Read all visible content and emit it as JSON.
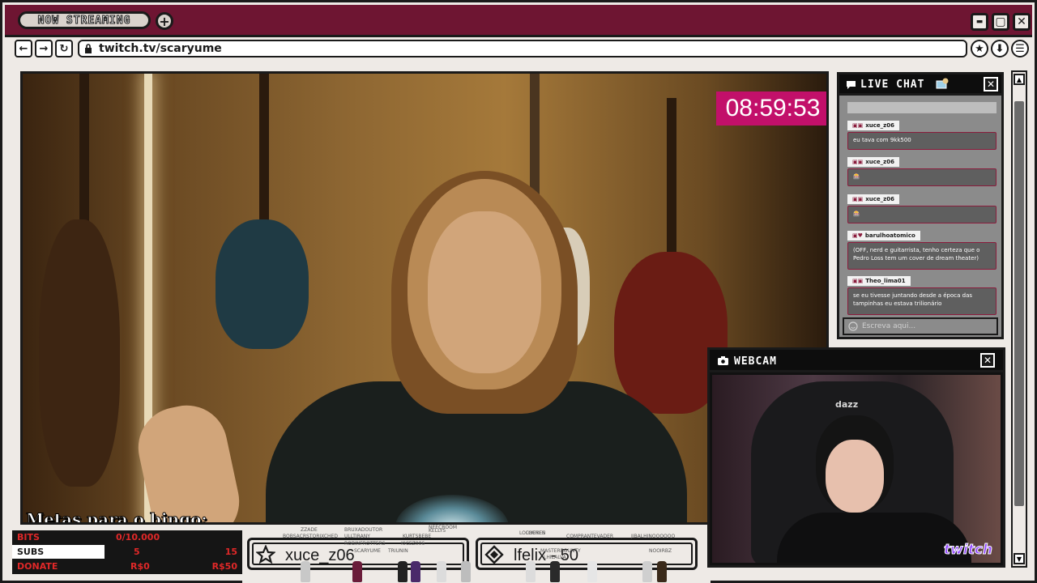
{
  "titlebar": {
    "now_streaming": "NOW STREAMING",
    "plus_icon": "+",
    "minimize_icon": "▬",
    "maximize_icon": "▢",
    "close_icon": "✕"
  },
  "navbar": {
    "back_icon": "←",
    "forward_icon": "→",
    "refresh_icon": "↻",
    "url": "twitch.tv/scaryume",
    "bookmark_icon": "★",
    "download_icon": "⬇",
    "menu_icon": "☰"
  },
  "stream": {
    "timer": "08:59:53",
    "bingo_title": "Metas para o bingo:",
    "goals": [
      {
        "label": "BITS",
        "v1": "0/10.000",
        "v2": "",
        "v3": ""
      },
      {
        "label": "SUBS",
        "v1": "5",
        "v2": "",
        "v3": "15"
      },
      {
        "label": "DONATE",
        "v1": "R$0",
        "v2": "",
        "v3": "R$50"
      }
    ],
    "subs_progress": 0.4
  },
  "bottom": {
    "box1_text": "xuce_z06",
    "box2_text": "lfelix - 50",
    "star_icon": "★",
    "diamond_icon": "◆",
    "tiny_names": [
      "ZZADE",
      "BRUXADOUTOR",
      "NEECROOM",
      "BOBSACRSTORIXCHED",
      "KELLYS",
      "ULLTIRANY",
      "KURTSBEBE",
      "ROBINFROTTERS",
      "KICEZ006",
      "SCARYUME",
      "TRIUNIN",
      "LOURES",
      "LOCHEYEN",
      "COMPRANTEVADER",
      "MASTERBOUNTY",
      "LHILALVA",
      "NOOIRBZ",
      "JIBALHINOOOOOO"
    ]
  },
  "chat": {
    "title": "LIVE CHAT",
    "close_icon": "✕",
    "input_placeholder": "Escreva aqui...",
    "messages": [
      {
        "user": "xuce_z06",
        "text": "eu tava com 9kk500"
      },
      {
        "user": "xuce_z06",
        "text": "🎰"
      },
      {
        "user": "xuce_z06",
        "text": "🎰"
      },
      {
        "user": "barulhoatomico",
        "text": "(OFF, nerd e guitarrista, tenho certeza que o Pedro Loss tem um cover de dream theater)"
      },
      {
        "user": "Theo_lima01",
        "text": "se eu tivesse juntando desde a época das tampinhas eu estava trilionário"
      }
    ]
  },
  "webcam": {
    "title": "WEBCAM",
    "close_icon": "✕",
    "chair_brand": "dazz",
    "platform_logo": "twitch"
  },
  "colors": {
    "titlebar": "#6e1532",
    "timer_bg": "#c2106a",
    "frame_bg": "#eeeae6",
    "accent_red": "#e02828",
    "twitch_purple": "#9146ff"
  }
}
